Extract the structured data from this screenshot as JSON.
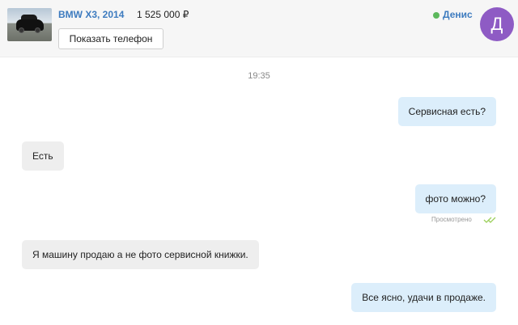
{
  "header": {
    "car_title": "BMW X3, 2014",
    "car_price": "1 525 000 ₽",
    "phone_button": "Показать телефон",
    "user_name": "Денис",
    "user_online": true,
    "avatar_letter": "Д",
    "avatar_color": "#8e5bc4"
  },
  "chat": {
    "time": "19:35",
    "messages": [
      {
        "direction": "outgoing",
        "text": "Сервисная есть?"
      },
      {
        "direction": "incoming",
        "text": "Есть"
      },
      {
        "direction": "outgoing",
        "text": "фото можно?",
        "status": "Просмотрено"
      },
      {
        "direction": "incoming",
        "text": "Я машину продаю а не фото сервисной книжки."
      },
      {
        "direction": "outgoing",
        "text": "Все ясно, удачи в продаже."
      }
    ]
  },
  "colors": {
    "outgoing_bubble": "#dceefb",
    "incoming_bubble": "#eeeeee",
    "link": "#3d7bbf",
    "online": "#5cb85c",
    "read_ticks": "#9bcf5a"
  },
  "icons": [
    "car-thumbnail",
    "online-dot-icon",
    "double-check-icon"
  ]
}
